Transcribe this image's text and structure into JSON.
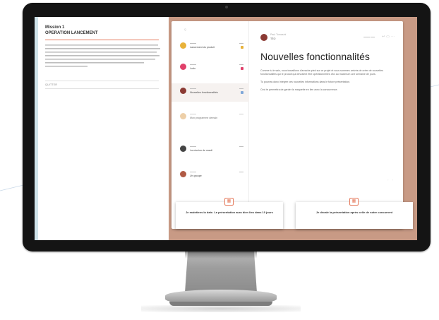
{
  "mission": {
    "label": "Mission 1",
    "title": "OPERATION LANCEMENT",
    "quit_label": "QUITTER"
  },
  "inbox": {
    "search_placeholder": "Q",
    "items": [
      {
        "subject": "Lancement du produit",
        "avatar_color": "#e8b23a",
        "dot_color": "#e8b23a"
      },
      {
        "subject": "Ludo",
        "avatar_color": "#e0406a",
        "dot_color": "#e0406a"
      },
      {
        "subject": "Nouvelles fonctionnalités",
        "avatar_color": "#8b3a34",
        "dot_color": "#7fa7d8"
      },
      {
        "subject": "Mon programme demain",
        "avatar_color": "#e8c08c",
        "dot_color": ""
      },
      {
        "subject": "La réunion de mardi",
        "avatar_color": "#444444",
        "dot_color": ""
      },
      {
        "subject": "Un groupe",
        "avatar_color": "#b05a44",
        "dot_color": ""
      }
    ]
  },
  "email": {
    "sender_name": "Paul Tomasini",
    "to_label": "TÉO",
    "subject": "Nouvelles fonctionnalités",
    "paragraphs": [
      "Comme tu le sais, nous travaillons d'arrache-pied sur ce projet et nous sommes arrivés de créer de nouvelles fonctionnalités qui le produit qui devraient être opérationnelles d'ici au maximum une semaine de jours.",
      "Tu pourras donc intégrer ces nouvelles informations dans le future présentation.",
      "Ceci te permettra de garder la maquette en lien avec la concurrence."
    ]
  },
  "choices": [
    {
      "text": "Je maintiens la date. La présentation aura bien lieu dans 10 jours",
      "icon": "calendar-icon"
    },
    {
      "text": "Je décale la présentation après celle de notre concurrent",
      "icon": "calendar-icon"
    }
  ],
  "colors": {
    "accent": "#e57a5c",
    "right_background": "#c89a85",
    "sidebar_stripe": "#cfe3ea"
  }
}
